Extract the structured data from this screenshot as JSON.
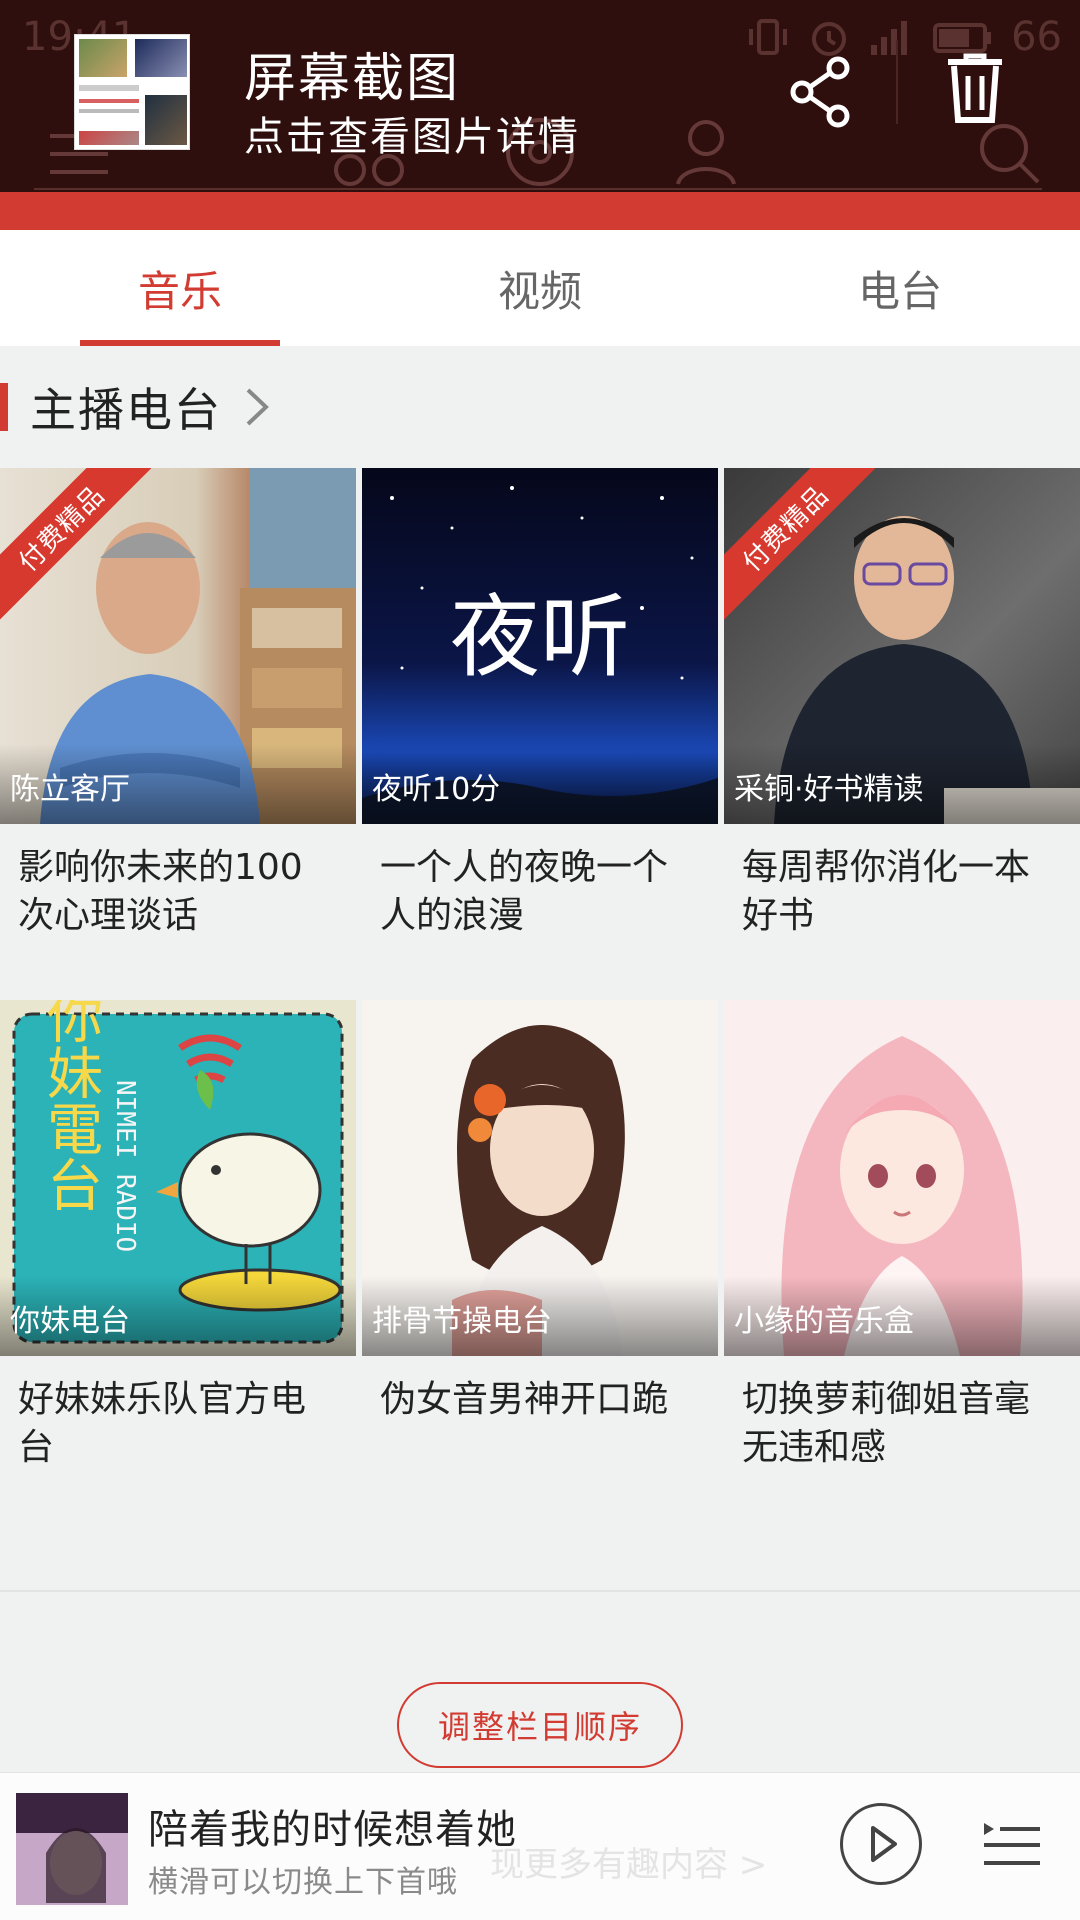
{
  "status_bar": {
    "time": "19:41",
    "battery": "66"
  },
  "notification": {
    "title": "屏幕截图",
    "subtitle": "点击查看图片详情"
  },
  "tabs": [
    {
      "label": "音乐",
      "active": true
    },
    {
      "label": "视频",
      "active": false
    },
    {
      "label": "电台",
      "active": false
    }
  ],
  "section": {
    "title": "主播电台"
  },
  "paid_badge": "付费精品",
  "cards": [
    {
      "caption": "陈立客厅",
      "title": "影响你未来的100次心理谈话",
      "paid": true
    },
    {
      "caption": "夜听10分",
      "title": "一个人的夜晚一个人的浪漫",
      "paid": false,
      "art_text": "夜听"
    },
    {
      "caption": "采铜·好书精读",
      "title": "每周帮你消化一本好书",
      "paid": true
    },
    {
      "caption": "你妹电台",
      "title": "好妹妹乐队官方电台",
      "paid": false,
      "art_text": "你妹電台",
      "art_side_text": "NIMEI RADIO"
    },
    {
      "caption": "排骨节操电台",
      "title": "伪女音男神开口跪",
      "paid": false
    },
    {
      "caption": "小缘的音乐盒",
      "title": "切换萝莉御姐音毫无违和感",
      "paid": false
    }
  ],
  "reorder_button": "调整栏目顺序",
  "player": {
    "song": "陪着我的时候想着她",
    "hint": "横滑可以切换上下首哦",
    "ghost_text": "现更多有趣内容 >"
  },
  "colors": {
    "accent": "#d23b31",
    "overlay": "#2e0f0d",
    "background": "#f0f2f2"
  }
}
